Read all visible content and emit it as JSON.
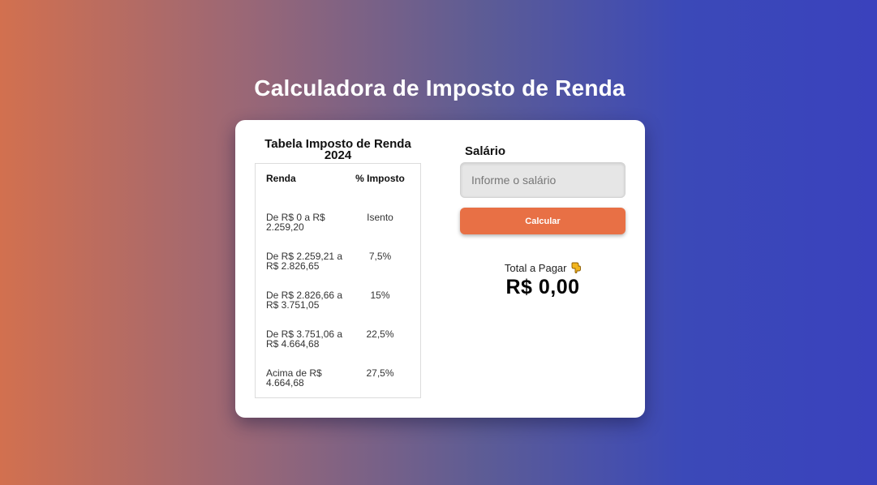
{
  "page": {
    "title": "Calculadora de Imposto de Renda"
  },
  "tax_table": {
    "title": "Tabela Imposto de Renda 2024",
    "headers": [
      "Renda",
      "% Imposto"
    ],
    "rows": [
      {
        "range": "De R$ 0 a R$ 2.259,20",
        "rate": "Isento"
      },
      {
        "range": "De R$ 2.259,21 a R$ 2.826,65",
        "rate": "7,5%"
      },
      {
        "range": "De R$ 2.826,66 a R$ 3.751,05",
        "rate": "15%"
      },
      {
        "range": "De R$ 3.751,06 a R$ 4.664,68",
        "rate": "22,5%"
      },
      {
        "range": "Acima de R$ 4.664,68",
        "rate": "27,5%"
      }
    ]
  },
  "form": {
    "salary_label": "Salário",
    "salary_value": "",
    "salary_placeholder": "Informe o salário",
    "calculate_label": "Calcular"
  },
  "result": {
    "total_label": "Total a Pagar",
    "total_icon": "pointing-down-hand-icon",
    "total_value": "R$ 0,00"
  },
  "colors": {
    "gradient_left": "#d2704f",
    "gradient_right": "#3a42bd",
    "button": "#e87045",
    "card": "#ffffff"
  }
}
